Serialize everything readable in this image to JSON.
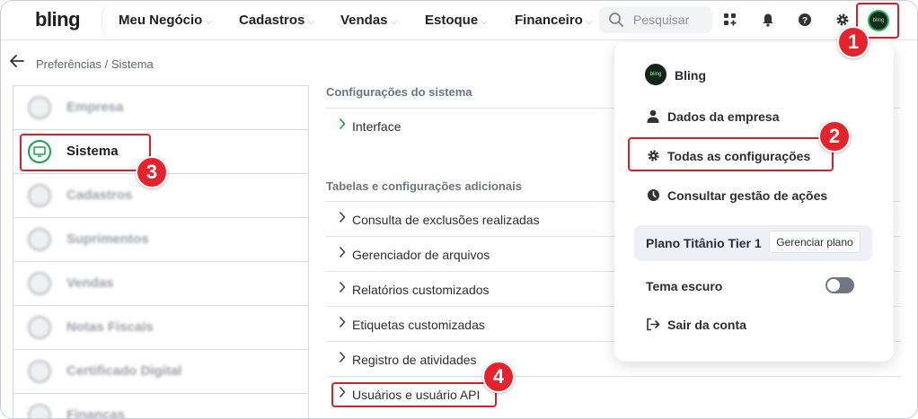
{
  "app": {
    "logo": "bling"
  },
  "nav": {
    "items": [
      {
        "label": "Meu Negócio"
      },
      {
        "label": "Cadastros"
      },
      {
        "label": "Vendas"
      },
      {
        "label": "Estoque"
      },
      {
        "label": "Financeiro"
      }
    ],
    "search_placeholder": "Pesquisar",
    "avatar_text": "bling"
  },
  "breadcrumb": "Preferências / Sistema",
  "sidebar": {
    "items": [
      {
        "label": "Empresa"
      },
      {
        "label": "Sistema"
      },
      {
        "label": "Cadastros"
      },
      {
        "label": "Suprimentos"
      },
      {
        "label": "Vendas"
      },
      {
        "label": "Notas Fiscais"
      },
      {
        "label": "Certificado Digital"
      },
      {
        "label": "Finanças"
      }
    ]
  },
  "content": {
    "section1_title": "Configurações do sistema",
    "section1_rows": [
      "Interface"
    ],
    "section2_title": "Tabelas e configurações adicionais",
    "section2_rows": [
      "Consulta de exclusões realizadas",
      "Gerenciador de arquivos",
      "Relatórios customizados",
      "Etiquetas customizadas",
      "Registro de atividades",
      "Usuários e usuário API"
    ]
  },
  "dropdown": {
    "account_name": "Bling",
    "avatar_text": "bling",
    "company_data": "Dados da empresa",
    "all_settings": "Todas as configurações",
    "actions_log": "Consultar gestão de ações",
    "plan_name": "Plano Titânio Tier 1",
    "manage_plan": "Gerenciar plano",
    "dark_theme": "Tema escuro",
    "dark_theme_on": false,
    "logout": "Sair da conta"
  },
  "badges": {
    "b1": "1",
    "b2": "2",
    "b3": "3",
    "b4": "4"
  },
  "colors": {
    "accent": "#18a34a",
    "highlight": "#d9202a",
    "badge": "#e5232d"
  }
}
